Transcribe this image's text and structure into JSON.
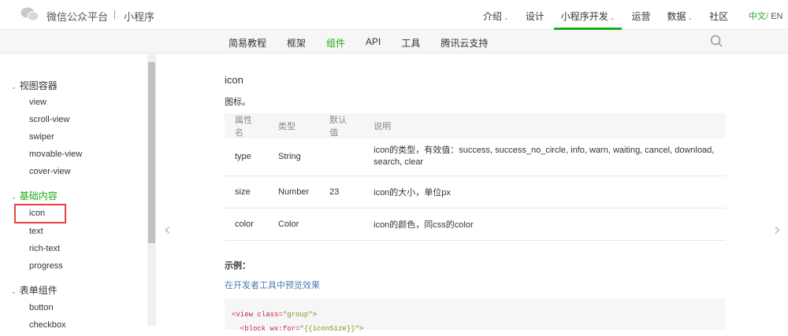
{
  "header": {
    "brand": "微信公众平台",
    "separator": "|",
    "product": "小程序",
    "nav": [
      {
        "label": "介绍",
        "dropdown": true
      },
      {
        "label": "设计",
        "dropdown": false
      },
      {
        "label": "小程序开发",
        "dropdown": true,
        "active": true
      },
      {
        "label": "运营",
        "dropdown": false
      },
      {
        "label": "数据",
        "dropdown": true
      },
      {
        "label": "社区",
        "dropdown": false
      }
    ],
    "lang_zh": "中文",
    "lang_sep": "/",
    "lang_en": "EN"
  },
  "subnav": [
    "简易教程",
    "框架",
    "组件",
    "API",
    "工具",
    "腾讯云支持"
  ],
  "subnav_active": "组件",
  "sidebar": {
    "groups": [
      {
        "title": "视图容器",
        "items": [
          "view",
          "scroll-view",
          "swiper",
          "movable-view",
          "cover-view"
        ]
      },
      {
        "title": "基础内容",
        "active": true,
        "items": [
          "icon",
          "text",
          "rich-text",
          "progress"
        ]
      },
      {
        "title": "表单组件",
        "items": [
          "button",
          "checkbox"
        ]
      }
    ],
    "selected": "icon"
  },
  "content": {
    "title": "icon",
    "description": "图标。",
    "table": {
      "headers": [
        "属性名",
        "类型",
        "默认值",
        "说明"
      ],
      "rows": [
        [
          "type",
          "String",
          "",
          "icon的类型，有效值：success, success_no_circle, info, warn, waiting, cancel, download, search, clear"
        ],
        [
          "size",
          "Number",
          "23",
          "icon的大小，单位px"
        ],
        [
          "color",
          "Color",
          "",
          "icon的颜色，同css的color"
        ]
      ]
    },
    "example_label": "示例：",
    "preview_link": "在开发者工具中预览效果",
    "code": [
      {
        "tag": "<view class=",
        "str": "\"group\"",
        "end": ">"
      },
      {
        "tag": "  <block wx:for=",
        "str": "\"{{iconSize}}\"",
        "end": ">"
      }
    ]
  },
  "colors": {
    "accent": "#1aad19",
    "highlight": "#e64340",
    "link": "#4a7bb7"
  }
}
